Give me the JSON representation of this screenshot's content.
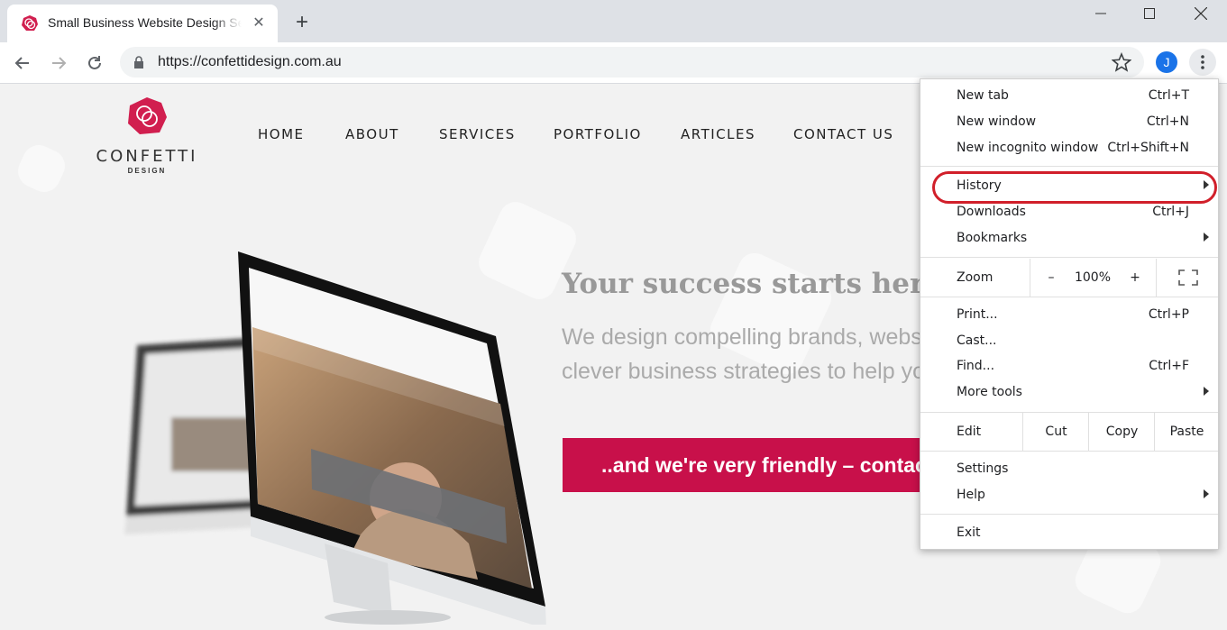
{
  "browser": {
    "tab": {
      "title": "Small Business Website Design Se"
    },
    "url": "https://confettidesign.com.au",
    "avatar_initial": "J"
  },
  "site": {
    "logo": {
      "word": "CONFETTI",
      "sub": "DESIGN"
    },
    "nav": [
      "HOME",
      "ABOUT",
      "SERVICES",
      "PORTFOLIO",
      "ARTICLES",
      "CONTACT US"
    ],
    "hero_title": "Your success starts here",
    "hero_sub_line1": "We design compelling brands, websites",
    "hero_sub_line2": "clever business strategies to help you",
    "cta": "..and we're very friendly – contact",
    "colors": {
      "brand": "#c8104a"
    }
  },
  "menu": {
    "new_tab": {
      "label": "New tab",
      "shortcut": "Ctrl+T"
    },
    "new_window": {
      "label": "New window",
      "shortcut": "Ctrl+N"
    },
    "new_incognito": {
      "label": "New incognito window",
      "shortcut": "Ctrl+Shift+N"
    },
    "history": {
      "label": "History"
    },
    "downloads": {
      "label": "Downloads",
      "shortcut": "Ctrl+J"
    },
    "bookmarks": {
      "label": "Bookmarks"
    },
    "zoom": {
      "label": "Zoom",
      "minus": "–",
      "value": "100%",
      "plus": "+"
    },
    "print": {
      "label": "Print...",
      "shortcut": "Ctrl+P"
    },
    "cast": {
      "label": "Cast..."
    },
    "find": {
      "label": "Find...",
      "shortcut": "Ctrl+F"
    },
    "more_tools": {
      "label": "More tools"
    },
    "edit": {
      "label": "Edit",
      "cut": "Cut",
      "copy": "Copy",
      "paste": "Paste"
    },
    "settings": {
      "label": "Settings"
    },
    "help": {
      "label": "Help"
    },
    "exit": {
      "label": "Exit"
    },
    "highlight_color": "#d11f2a"
  }
}
